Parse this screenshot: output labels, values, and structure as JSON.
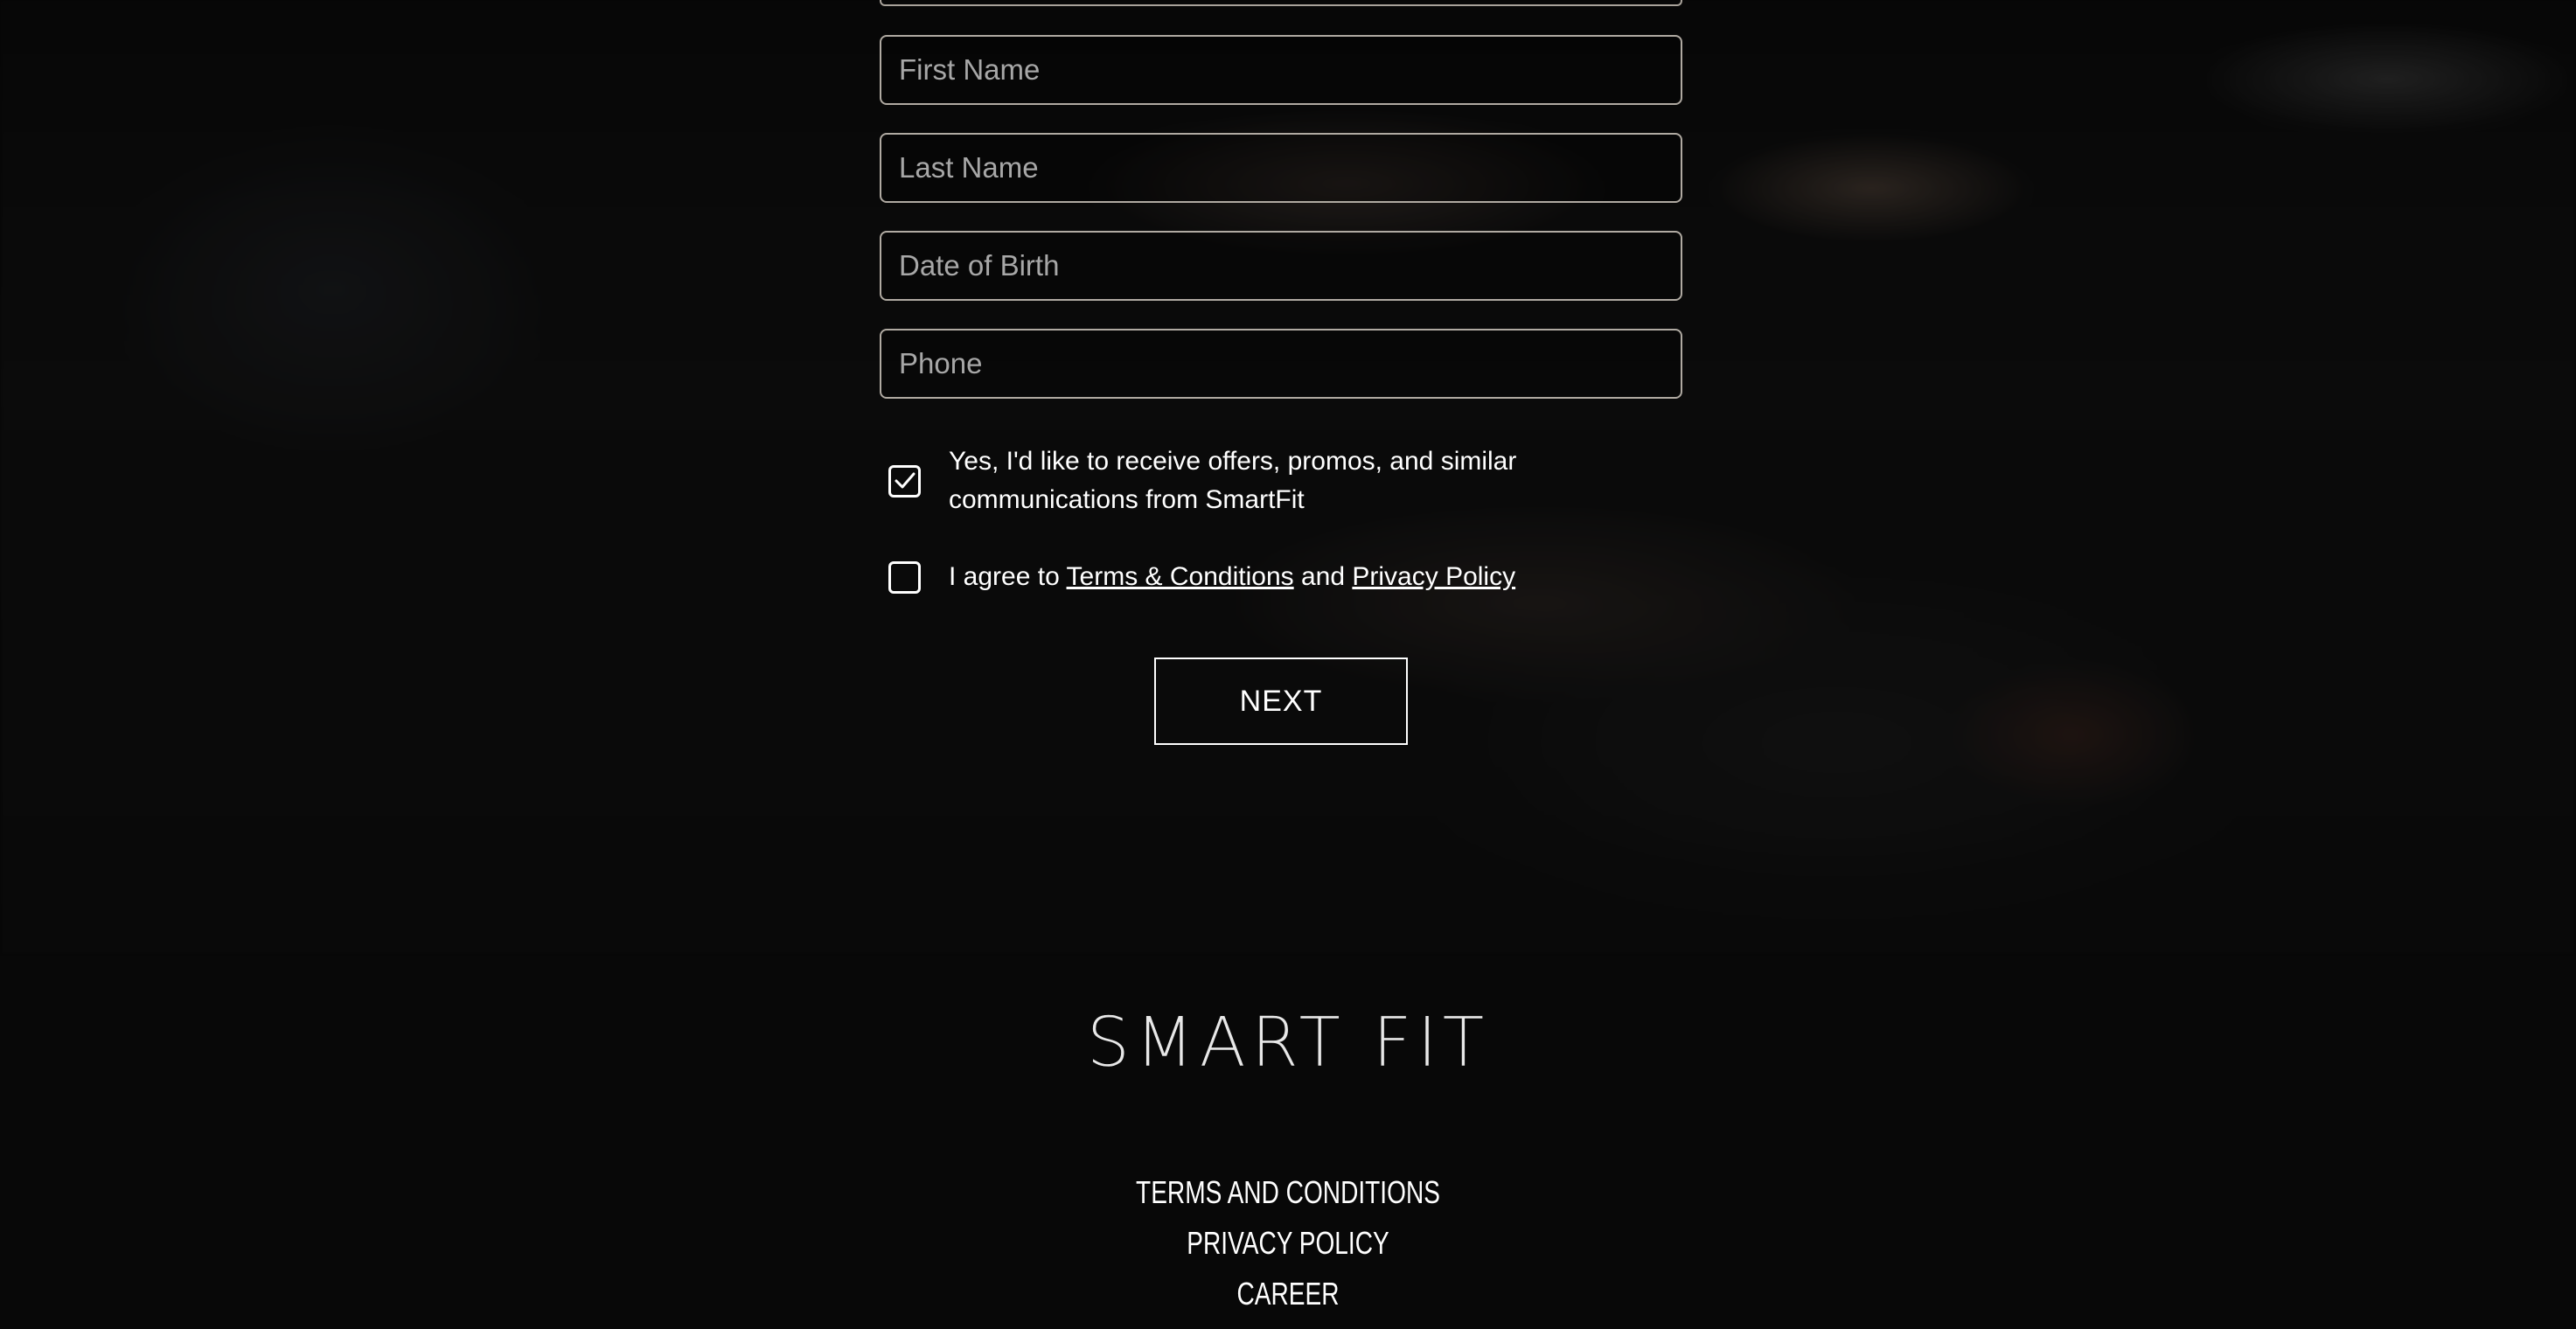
{
  "form": {
    "first_name_placeholder": "First Name",
    "last_name_placeholder": "Last Name",
    "dob_placeholder": "Date of Birth",
    "phone_placeholder": "Phone",
    "offers_opt_in": {
      "checked": true,
      "line1": "Yes, I'd like to receive offers, promos, and similar",
      "line2": "communications from SmartFit"
    },
    "agree": {
      "checked": false,
      "prefix": "I agree to ",
      "terms_link": "Terms & Conditions",
      "middle": " and ",
      "privacy_link": "Privacy Policy"
    },
    "next_label": "NEXT"
  },
  "footer": {
    "logo": "SMART FIT",
    "links": [
      "TERMS AND CONDITIONS",
      "PRIVACY POLICY",
      "CAREER"
    ]
  },
  "icons": {
    "checkmark": "checkmark-icon"
  }
}
